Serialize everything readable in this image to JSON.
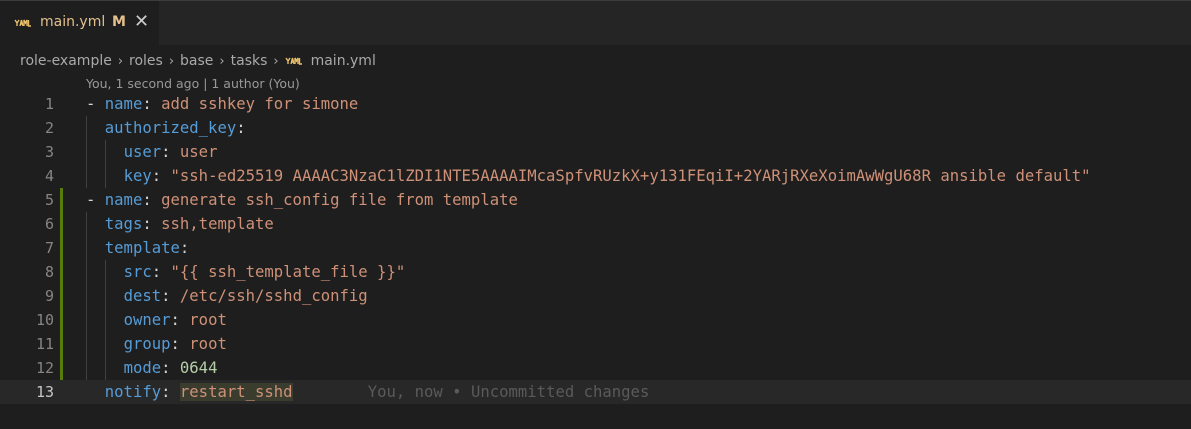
{
  "tab": {
    "title": "main.yml",
    "status": "M",
    "close_glyph": "✕",
    "icon": "yaml-file-icon",
    "title_color": "#e2c08d"
  },
  "breadcrumb": {
    "items": [
      "role-example",
      "roles",
      "base",
      "tasks",
      "main.yml"
    ],
    "separator": "›"
  },
  "codelens": "You, 1 second ago | 1 author (You)",
  "editor": {
    "lines": [
      {
        "num": "1"
      },
      {
        "num": "2"
      },
      {
        "num": "3"
      },
      {
        "num": "4"
      },
      {
        "num": "5"
      },
      {
        "num": "6"
      },
      {
        "num": "7"
      },
      {
        "num": "8"
      },
      {
        "num": "9"
      },
      {
        "num": "10"
      },
      {
        "num": "11"
      },
      {
        "num": "12"
      },
      {
        "num": "13"
      }
    ],
    "code": {
      "l1": {
        "dash": "- ",
        "key": "name",
        "colon": ": ",
        "value": "add sshkey for simone"
      },
      "l2": {
        "key": "authorized_key",
        "colon": ":"
      },
      "l3": {
        "key": "user",
        "colon": ": ",
        "value": "user"
      },
      "l4": {
        "key": "key",
        "colon": ": ",
        "value": "\"ssh-ed25519 AAAAC3NzaC1lZDI1NTE5AAAAIMcaSpfvRUzkX+y131FEqiI+2YARjRXeXoimAwWgU68R ansible default\""
      },
      "l5": {
        "dash": "- ",
        "key": "name",
        "colon": ": ",
        "value": "generate ssh_config file from template"
      },
      "l6": {
        "key": "tags",
        "colon": ": ",
        "value": "ssh,template"
      },
      "l7": {
        "key": "template",
        "colon": ":"
      },
      "l8": {
        "key": "src",
        "colon": ": ",
        "value": "\"{{ ssh_template_file }}\""
      },
      "l9": {
        "key": "dest",
        "colon": ": ",
        "value": "/etc/ssh/sshd_config"
      },
      "l10": {
        "key": "owner",
        "colon": ": ",
        "value": "root"
      },
      "l11": {
        "key": "group",
        "colon": ": ",
        "value": "root"
      },
      "l12": {
        "key": "mode",
        "colon": ": ",
        "value": "0644"
      },
      "l13": {
        "key": "notify",
        "colon": ": ",
        "value": "restart_sshd"
      }
    },
    "inline_blame": "You, now • Uncommitted changes"
  },
  "colors": {
    "key": "#569cd6",
    "string": "#ce9178",
    "number": "#b5cea8",
    "modified_gutter": "#587c0c"
  }
}
